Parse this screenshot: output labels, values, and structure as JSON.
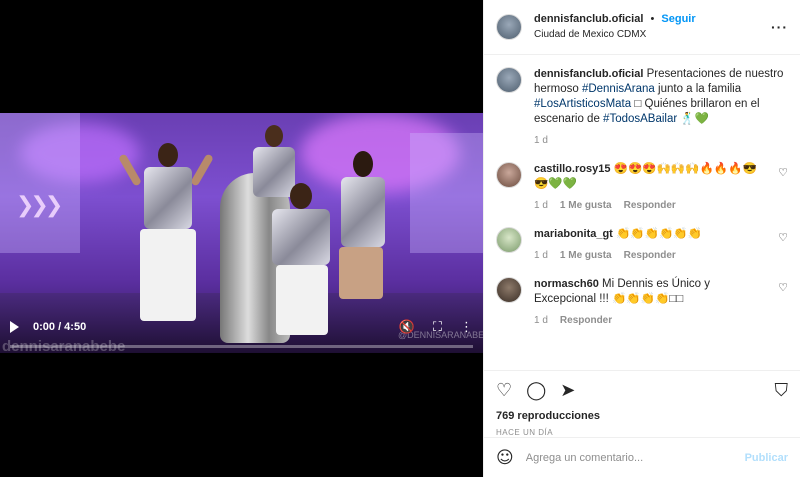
{
  "post": {
    "username": "dennisfanclub.oficial",
    "follow_label": "Seguir",
    "location": "Ciudad de Mexico CDMX",
    "more_icon": "more-horizontal-icon",
    "caption": {
      "username": "dennisfanclub.oficial",
      "text_1": "Presentaciones de nuestro hermoso ",
      "tag_1": "#DennisArana",
      "text_2": " junto a la familia ",
      "tag_2": "#LosArtisticosMata",
      "text_3": " □ Quiénes brillaron en el escenario de ",
      "tag_3": "#TodosABailar",
      "text_4": " 🕺💚",
      "age": "1 d"
    }
  },
  "video": {
    "time": "0:00 / 4:50",
    "progress": 0,
    "watermark": "dennisaranabebe",
    "watermark_small": "@DENNISARANABEB"
  },
  "comments": [
    {
      "username": "castillo.rosy15",
      "text": "😍😍😍🙌🙌🙌🔥🔥🔥😎😎💚💚",
      "age": "1 d",
      "likes": "1 Me gusta",
      "reply": "Responder"
    },
    {
      "username": "mariabonita_gt",
      "text": "👏👏👏👏👏👏",
      "age": "1 d",
      "likes": "1 Me gusta",
      "reply": "Responder"
    },
    {
      "username": "normasch60",
      "text": "Mi Dennis es Único y Excepcional !!! 👏👏👏👏□□",
      "age": "1 d",
      "likes": "",
      "reply": "Responder"
    }
  ],
  "actions": {
    "views": "769 reproducciones",
    "ago": "HACE UN DÍA"
  },
  "composer": {
    "placeholder": "Agrega un comentario...",
    "publish_label": "Publicar"
  },
  "colors": {
    "accent": "#0095f6",
    "publish_disabled": "#b2dffc",
    "link": "#00376b",
    "muted": "#8e8e8e"
  }
}
